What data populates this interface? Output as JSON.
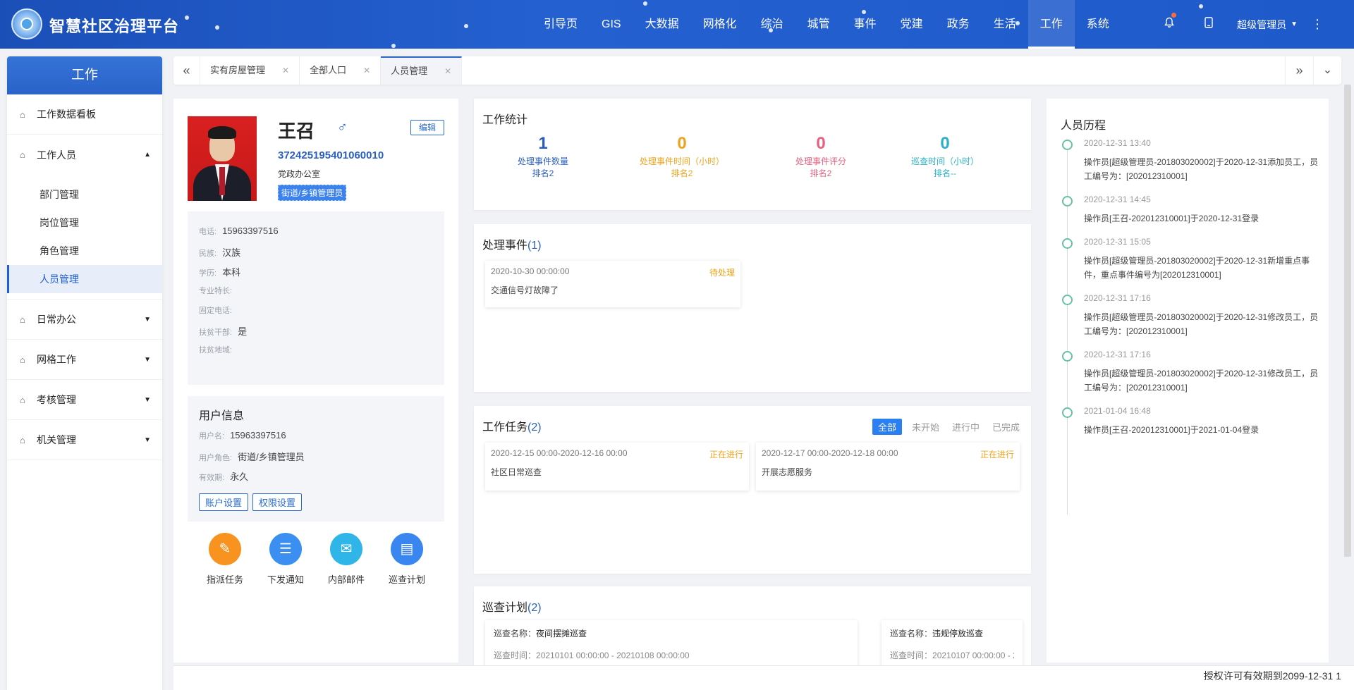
{
  "app": {
    "title": "智慧社区治理平台"
  },
  "nav": [
    {
      "label": "引导页"
    },
    {
      "label": "GIS"
    },
    {
      "label": "大数据"
    },
    {
      "label": "网格化"
    },
    {
      "label": "综治"
    },
    {
      "label": "城管"
    },
    {
      "label": "事件"
    },
    {
      "label": "党建"
    },
    {
      "label": "政务"
    },
    {
      "label": "生活"
    },
    {
      "label": "工作"
    },
    {
      "label": "系统"
    }
  ],
  "user": {
    "name": "超级管理员"
  },
  "sidebar": {
    "title": "工作",
    "dashboard": "工作数据看板",
    "staff": "工作人员",
    "staff_items": [
      "部门管理",
      "岗位管理",
      "角色管理",
      "人员管理"
    ],
    "groups": [
      "日常办公",
      "网格工作",
      "考核管理",
      "机关管理"
    ]
  },
  "tabs": [
    {
      "label": "实有房屋管理"
    },
    {
      "label": "全部人口"
    },
    {
      "label": "人员管理"
    }
  ],
  "profile": {
    "name": "王召",
    "gender_symbol": "♂",
    "edit": "编辑",
    "id_number": "372425195401060010",
    "department": "党政办公室",
    "role_tag": "街道/乡镇管理员",
    "info": [
      {
        "k": "电话:",
        "v": "15963397516"
      },
      {
        "k": "民族:",
        "v": "汉族"
      },
      {
        "k": "学历:",
        "v": "本科"
      },
      {
        "k": "专业特长:",
        "v": ""
      },
      {
        "k": "固定电话:",
        "v": ""
      },
      {
        "k": "扶贫干部:",
        "v": "是"
      },
      {
        "k": "扶贫地域:",
        "v": ""
      }
    ],
    "user_info_title": "用户信息",
    "user_info": [
      {
        "k": "用户名:",
        "v": "15963397516"
      },
      {
        "k": "用户角色:",
        "v": "街道/乡镇管理员"
      },
      {
        "k": "有效期:",
        "v": "永久"
      }
    ],
    "account_btn": "账户设置",
    "perm_btn": "权限设置",
    "actions": [
      {
        "label": "指派任务",
        "color": "#f7931e"
      },
      {
        "label": "下发通知",
        "color": "#3b8ff0"
      },
      {
        "label": "内部邮件",
        "color": "#2fb5e8"
      },
      {
        "label": "巡查计划",
        "color": "#3a86f0"
      }
    ]
  },
  "stats": {
    "title": "工作统计",
    "items": [
      {
        "num": "1",
        "label": "处理事件数量",
        "rank": "排名2",
        "color": "#2a5fc1"
      },
      {
        "num": "0",
        "label": "处理事件时间（小时）",
        "rank": "排名2",
        "color": "#f0a21b"
      },
      {
        "num": "0",
        "label": "处理事件评分",
        "rank": "排名2",
        "color": "#e8607f"
      },
      {
        "num": "0",
        "label": "巡查时间（小时）",
        "rank": "排名--",
        "color": "#2ab0c9"
      }
    ]
  },
  "events": {
    "title": "处理事件",
    "count": "(1)",
    "items": [
      {
        "time": "2020-10-30 00:00:00",
        "status": "待处理",
        "desc": "交通信号灯故障了"
      }
    ]
  },
  "tasks": {
    "title": "工作任务",
    "count": "(2)",
    "filters": [
      "全部",
      "未开始",
      "进行中",
      "已完成"
    ],
    "items": [
      {
        "time": "2020-12-15 00:00-2020-12-16 00:00",
        "status": "正在进行",
        "desc": "社区日常巡查"
      },
      {
        "time": "2020-12-17 00:00-2020-12-18 00:00",
        "status": "正在进行",
        "desc": "开展志愿服务"
      }
    ]
  },
  "patrol": {
    "title": "巡查计划",
    "count": "(2)",
    "name_label": "巡查名称：",
    "time_label": "巡查时间：",
    "items": [
      {
        "name": "夜间摆摊巡查",
        "time": "20210101 00:00:00 - 20210108 00:00:00"
      },
      {
        "name": "违规停放巡查",
        "time": "20210107 00:00:00 - 2"
      }
    ]
  },
  "history": {
    "title": "人员历程",
    "items": [
      {
        "time": "2020-12-31 13:40",
        "desc": "操作员[超级管理员-201803020002]于2020-12-31添加员工，员工编号为：[202012310001]"
      },
      {
        "time": "2020-12-31 14:45",
        "desc": "操作员[王召-202012310001]于2020-12-31登录"
      },
      {
        "time": "2020-12-31 15:05",
        "desc": "操作员[超级管理员-201803020002]于2020-12-31新增重点事件，重点事件编号为[202012310001]"
      },
      {
        "time": "2020-12-31 17:16",
        "desc": "操作员[超级管理员-201803020002]于2020-12-31修改员工，员工编号为：[202012310001]"
      },
      {
        "time": "2020-12-31 17:16",
        "desc": "操作员[超级管理员-201803020002]于2020-12-31修改员工，员工编号为：[202012310001]"
      },
      {
        "time": "2021-01-04 16:48",
        "desc": "操作员[王召-202012310001]于2021-01-04登录"
      }
    ]
  },
  "footer": {
    "license": "授权许可有效期到2099-12-31 1"
  }
}
